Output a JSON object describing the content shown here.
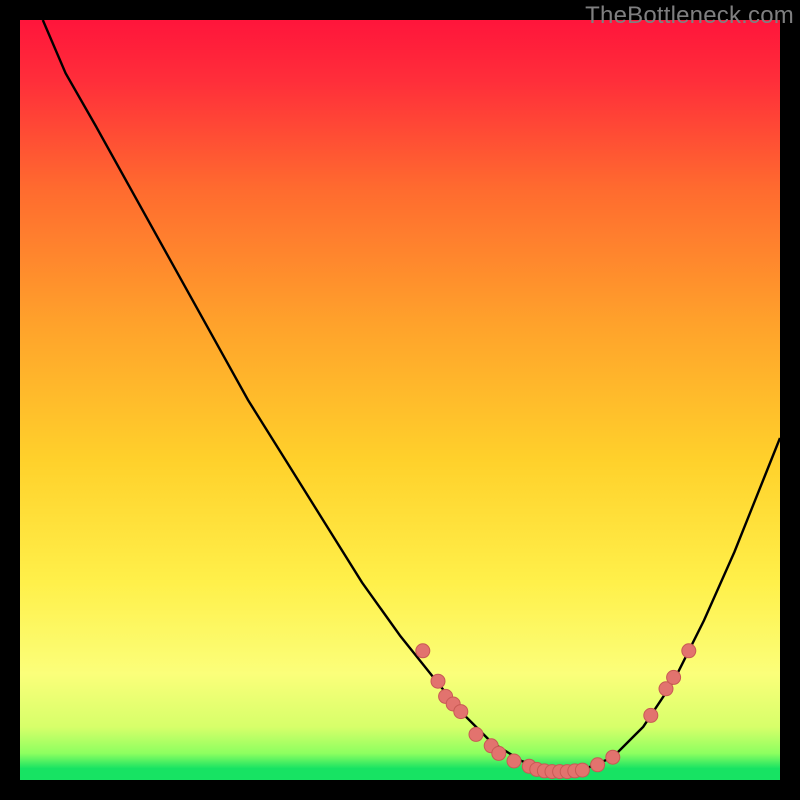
{
  "watermark": "TheBottleneck.com",
  "colors": {
    "bg_black": "#000000",
    "curve": "#000000",
    "dot_fill": "#e2736e",
    "dot_stroke": "#c85a55",
    "grad_top": "#ff153b",
    "grad_mid1": "#ff6a2f",
    "grad_mid2": "#ffd12b",
    "grad_mid3": "#fff56a",
    "grad_band": "#d7ff6a",
    "grad_green": "#17e363"
  },
  "chart_data": {
    "type": "line",
    "title": "",
    "xlabel": "",
    "ylabel": "",
    "xlim": [
      0,
      100
    ],
    "ylim": [
      0,
      100
    ],
    "curve": [
      {
        "x": 3,
        "y": 100
      },
      {
        "x": 6,
        "y": 93
      },
      {
        "x": 10,
        "y": 86
      },
      {
        "x": 15,
        "y": 77
      },
      {
        "x": 20,
        "y": 68
      },
      {
        "x": 25,
        "y": 59
      },
      {
        "x": 30,
        "y": 50
      },
      {
        "x": 35,
        "y": 42
      },
      {
        "x": 40,
        "y": 34
      },
      {
        "x": 45,
        "y": 26
      },
      {
        "x": 50,
        "y": 19
      },
      {
        "x": 54,
        "y": 14
      },
      {
        "x": 58,
        "y": 9
      },
      {
        "x": 62,
        "y": 5
      },
      {
        "x": 66,
        "y": 2.5
      },
      {
        "x": 70,
        "y": 1.2
      },
      {
        "x": 74,
        "y": 1.3
      },
      {
        "x": 78,
        "y": 3
      },
      {
        "x": 82,
        "y": 7
      },
      {
        "x": 86,
        "y": 13
      },
      {
        "x": 90,
        "y": 21
      },
      {
        "x": 94,
        "y": 30
      },
      {
        "x": 98,
        "y": 40
      },
      {
        "x": 100,
        "y": 45
      }
    ],
    "dots": [
      {
        "x": 53,
        "y": 17
      },
      {
        "x": 55,
        "y": 13
      },
      {
        "x": 56,
        "y": 11
      },
      {
        "x": 57,
        "y": 10
      },
      {
        "x": 58,
        "y": 9
      },
      {
        "x": 60,
        "y": 6
      },
      {
        "x": 62,
        "y": 4.5
      },
      {
        "x": 63,
        "y": 3.5
      },
      {
        "x": 65,
        "y": 2.5
      },
      {
        "x": 67,
        "y": 1.8
      },
      {
        "x": 68,
        "y": 1.4
      },
      {
        "x": 69,
        "y": 1.2
      },
      {
        "x": 70,
        "y": 1.1
      },
      {
        "x": 71,
        "y": 1.1
      },
      {
        "x": 72,
        "y": 1.1
      },
      {
        "x": 73,
        "y": 1.2
      },
      {
        "x": 74,
        "y": 1.3
      },
      {
        "x": 76,
        "y": 2.0
      },
      {
        "x": 78,
        "y": 3.0
      },
      {
        "x": 83,
        "y": 8.5
      },
      {
        "x": 85,
        "y": 12
      },
      {
        "x": 86,
        "y": 13.5
      },
      {
        "x": 88,
        "y": 17
      }
    ]
  }
}
